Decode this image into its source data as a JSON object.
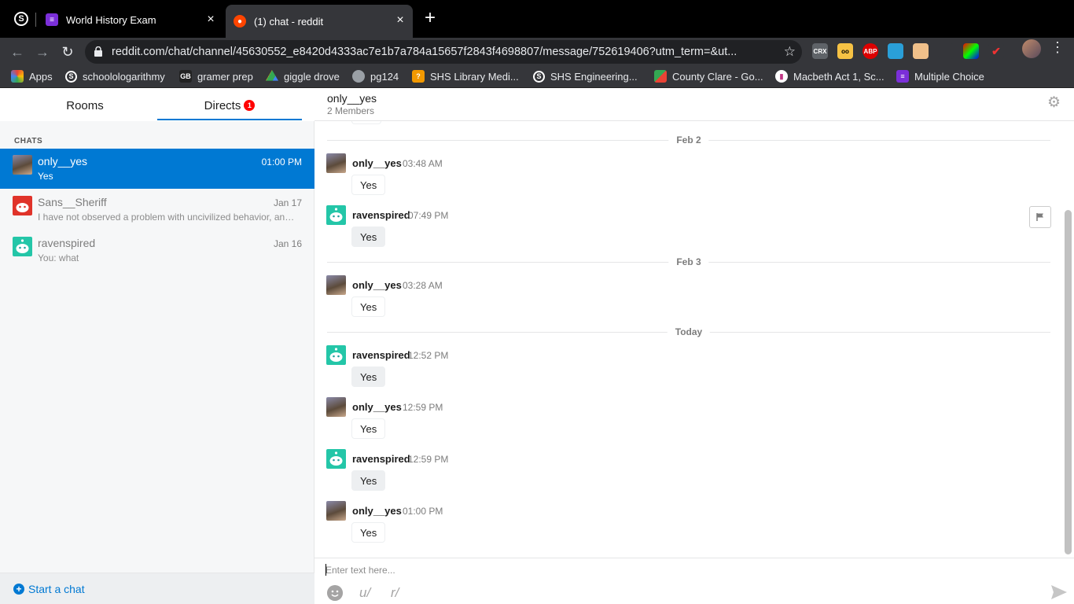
{
  "browser": {
    "tabs": [
      {
        "title": "World History Exam",
        "icon": "forms-icon"
      },
      {
        "title": "(1) chat - reddit",
        "icon": "reddit-icon"
      }
    ],
    "url": "reddit.com/chat/channel/45630552_e8420d4333ac7e1b7a784a15657f2843f4698807/message/752619406?utm_term=&ut...",
    "bookmarks": [
      {
        "label": "Apps",
        "icon": "apps-grid-icon",
        "color": "#ea4335"
      },
      {
        "label": "schoolologarithmy",
        "icon": "schoology-icon",
        "color": "#35363a"
      },
      {
        "label": "gramer prep",
        "icon": "gbi-icon",
        "color": "#222"
      },
      {
        "label": "giggle drove",
        "icon": "drive-icon",
        "color": "#1fa463"
      },
      {
        "label": "pg124",
        "icon": "globe-icon",
        "color": "#777"
      },
      {
        "label": "SHS Library Medi...",
        "icon": "library-icon",
        "color": "#f29900"
      },
      {
        "label": "SHS Engineering...",
        "icon": "schoology-icon",
        "color": "#35363a"
      },
      {
        "label": "County Clare - Go...",
        "icon": "maps-icon",
        "color": "#34a853"
      },
      {
        "label": "Macbeth Act 1, Sc...",
        "icon": "quiz-icon",
        "color": "#c13584"
      },
      {
        "label": "Multiple Choice",
        "icon": "forms-icon",
        "color": "#7b2fd9"
      }
    ],
    "extensions": [
      "CRX",
      "oo",
      "ABP",
      "",
      "",
      "",
      "",
      ""
    ]
  },
  "sidebar": {
    "tabs": {
      "rooms": "Rooms",
      "directs": "Directs",
      "directs_badge": "1"
    },
    "section_label": "CHATS",
    "chats": [
      {
        "name": "only__yes",
        "preview": "Yes",
        "time": "01:00 PM",
        "active": true
      },
      {
        "name": "Sans__Sheriff",
        "preview": "I have not observed a problem with uncivilized behavior, and I'm",
        "time": "Jan 17",
        "active": false
      },
      {
        "name": "ravenspired",
        "preview": "You: what",
        "time": "Jan 16",
        "active": false
      }
    ],
    "start_chat": "Start a chat"
  },
  "conversation": {
    "title": "only__yes",
    "members": "2 Members",
    "date_separators": [
      "Feb 2",
      "Feb 3",
      "Today"
    ],
    "messages": [
      {
        "user": "only__yes",
        "time": "03:48 AM",
        "text": "Yes",
        "mine": false
      },
      {
        "user": "ravenspired",
        "time": "07:49 PM",
        "text": "Yes",
        "mine": true
      },
      {
        "user": "only__yes",
        "time": "03:28 AM",
        "text": "Yes",
        "mine": false
      },
      {
        "user": "ravenspired",
        "time": "12:52 PM",
        "text": "Yes",
        "mine": true
      },
      {
        "user": "only__yes",
        "time": "12:59 PM",
        "text": "Yes",
        "mine": false
      },
      {
        "user": "ravenspired",
        "time": "12:59 PM",
        "text": "Yes",
        "mine": true
      },
      {
        "user": "only__yes",
        "time": "01:00 PM",
        "text": "Yes",
        "mine": false
      }
    ]
  },
  "composer": {
    "placeholder": "Enter text here...",
    "user_link": "u/",
    "subreddit_link": "r/"
  },
  "colors": {
    "accent": "#0079d3",
    "badge": "#ff0000",
    "snoo": "#24a0a0"
  }
}
